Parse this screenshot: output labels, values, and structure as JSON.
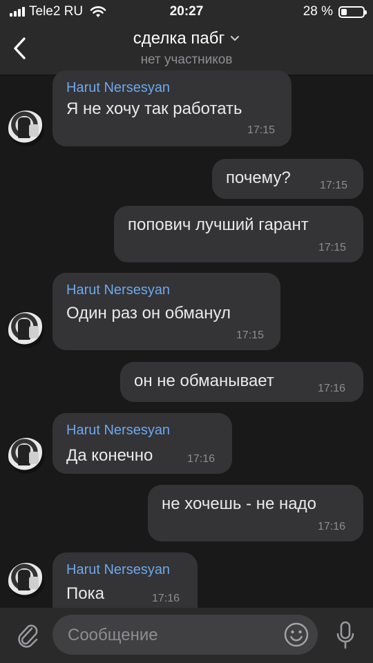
{
  "status_bar": {
    "carrier": "Tele2 RU",
    "time": "20:27",
    "battery_percent": "28 %",
    "battery_level": 0.28
  },
  "header": {
    "title": "сделка пабг",
    "subtitle": "нет участников",
    "back_icon": "chevron-left-icon",
    "dropdown_icon": "chevron-down-icon"
  },
  "messages": [
    {
      "direction": "in",
      "sender": "Harut Nersesyan",
      "text": "Я не хочу так работать",
      "time": "17:15"
    },
    {
      "direction": "out",
      "text": "почему?",
      "time": "17:15"
    },
    {
      "direction": "out",
      "text": "попович лучший гарант",
      "time": "17:15"
    },
    {
      "direction": "in",
      "sender": "Harut Nersesyan",
      "text": "Один раз он обманул",
      "time": "17:15"
    },
    {
      "direction": "out",
      "text": "он не обманывает",
      "time": "17:16"
    },
    {
      "direction": "in",
      "sender": "Harut Nersesyan",
      "text": "Да конечно",
      "time": "17:16"
    },
    {
      "direction": "out",
      "text": "не хочешь - не надо",
      "time": "17:16"
    },
    {
      "direction": "in",
      "sender": "Harut Nersesyan",
      "text": "Пока",
      "time": "17:16"
    }
  ],
  "input": {
    "placeholder": "Сообщение",
    "value": ""
  },
  "colors": {
    "background": "#19191a",
    "bar": "#2a2a2b",
    "bubble": "#343436",
    "sender_name": "#6ea8ec"
  }
}
